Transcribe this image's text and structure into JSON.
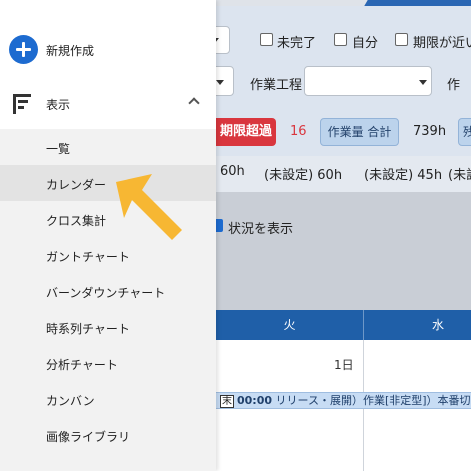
{
  "sidebar": {
    "new_item": {
      "label": "新規作成",
      "icon": "plus-circle-icon"
    },
    "view_item": {
      "label": "表示",
      "icon": "list-icon",
      "expanded": true
    },
    "sub_items": [
      {
        "label": "一覧"
      },
      {
        "label": "カレンダー",
        "selected": true
      },
      {
        "label": "クロス集計"
      },
      {
        "label": "ガントチャート"
      },
      {
        "label": "バーンダウンチャート"
      },
      {
        "label": "時系列チャート"
      },
      {
        "label": "分析チャート"
      },
      {
        "label": "カンバン"
      },
      {
        "label": "画像ライブラリ"
      }
    ]
  },
  "filters": {
    "incomplete_label": "未完了",
    "mine_label": "自分",
    "near_deadline_label": "期限が近い",
    "process_label": "作業工程",
    "cut_label": "作"
  },
  "stats": {
    "overdue_label": "期限超過",
    "overdue_count": "16",
    "workload_total_label": "作業量 合計",
    "workload_total_value": "739h",
    "cut_badge_label": "残",
    "hours_row": [
      "60h",
      "(未設定) 60h",
      "(未設定) 45h",
      "(未設"
    ]
  },
  "options": {
    "show_status_label": "状況を表示"
  },
  "calendar": {
    "days": [
      "火",
      "水"
    ],
    "date_label": "1日",
    "event": {
      "tag": "末",
      "time": "00:00",
      "text": "リリース・展開）作業[非定型]）本番切り替"
    }
  },
  "colors": {
    "accent": "#1d6bd0",
    "calendar_header": "#1f5fa8",
    "overdue": "#d9363e",
    "pointer": "#f7b733"
  }
}
